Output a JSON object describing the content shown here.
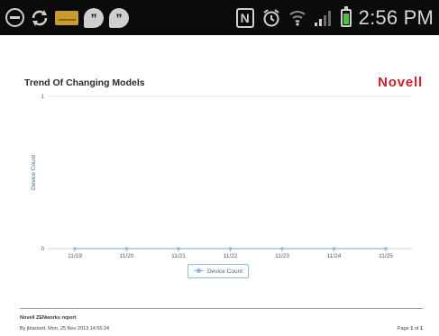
{
  "status_bar": {
    "time": "2:56 PM",
    "left_icons": [
      "minus-circle-icon",
      "sync-icon",
      "mail-icon",
      "hangouts-icon",
      "hangouts-icon"
    ],
    "right_icons": [
      "nfc-icon",
      "alarm-icon",
      "wifi-icon",
      "signal-icon",
      "battery-icon"
    ],
    "nfc_glyph": "N",
    "battery_color": "#4ec23f"
  },
  "report": {
    "title": "Trend Of Changing Models",
    "brand": "Novell",
    "brand_color": "#cc2229"
  },
  "chart_data": {
    "type": "line",
    "title": "Trend Of Changing Models",
    "ylabel": "Device Count",
    "xlabel": "",
    "categories": [
      "11/19",
      "11/20",
      "11/21",
      "11/22",
      "11/23",
      "11/24",
      "11/25"
    ],
    "series": [
      {
        "name": "Device Count",
        "values": [
          0,
          0,
          0,
          0,
          0,
          0,
          0
        ],
        "color": "#8fb7df"
      }
    ],
    "ylim": [
      0,
      1
    ],
    "yticks": [
      "0",
      "1"
    ],
    "grid": true,
    "legend": "bottom-center"
  },
  "footer": {
    "line1": "Novell ZENworks report",
    "line2": "By jblackett, Mon, 25 Nov 2013 14:56:24",
    "page_label": "Page",
    "page_current": "1",
    "page_of": "of",
    "page_total": "1"
  }
}
